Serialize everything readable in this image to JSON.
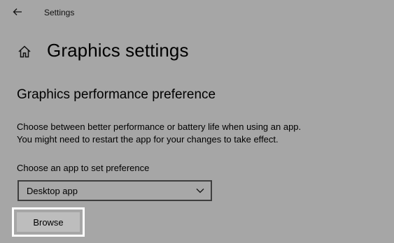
{
  "window": {
    "title": "Settings"
  },
  "header": {
    "title": "Graphics settings"
  },
  "section": {
    "title": "Graphics performance preference",
    "description_line1": "Choose between better performance or battery life when using an app.",
    "description_line2": "You might need to restart the app for your changes to take effect."
  },
  "app_picker": {
    "label": "Choose an app to set preference",
    "selected": "Desktop app"
  },
  "browse_button": {
    "label": "Browse"
  },
  "icons": {
    "back": "back-arrow-icon",
    "home": "home-icon",
    "dropdown": "chevron-down-icon"
  },
  "colors": {
    "background": "#a6a6a6",
    "focus_outline": "#ffffff",
    "button_bg": "#bdbdbd"
  }
}
